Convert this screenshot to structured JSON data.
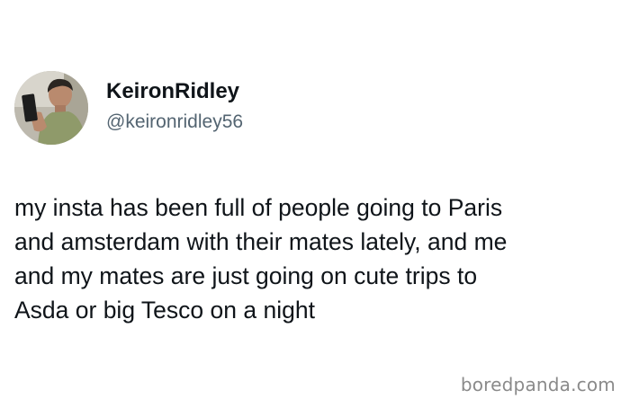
{
  "author": {
    "display_name": "KeironRidley",
    "handle": "@keironridley56",
    "avatar_icon": "profile-photo"
  },
  "tweet": {
    "lines": [
      "my insta has been full of people going to Paris",
      "and amsterdam with their mates lately, and me",
      "and my mates are just going on cute trips to",
      "Asda or big Tesco on a night"
    ]
  },
  "watermark": "boredpanda.com",
  "colors": {
    "text": "#0f1419",
    "handle": "#536471",
    "watermark": "#8a8a8a",
    "background": "#ffffff"
  }
}
